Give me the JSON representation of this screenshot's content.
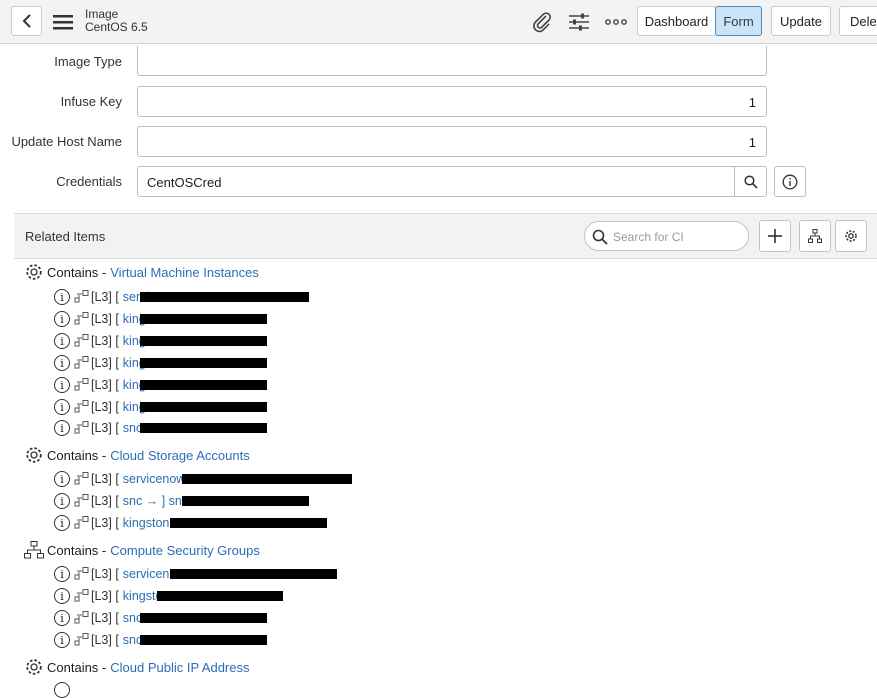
{
  "header": {
    "record_type": "Image",
    "record_name": "CentOS 6.5",
    "buttons": [
      "Dashboard",
      "Form",
      "Update",
      "Delet"
    ]
  },
  "form": {
    "fields": [
      {
        "label": "Image Type",
        "value": ""
      },
      {
        "label": "Infuse Key",
        "value": "1"
      },
      {
        "label": "Update Host Name",
        "value": "1"
      },
      {
        "label": "Credentials",
        "value": "CentOSCred"
      }
    ]
  },
  "related": {
    "title": "Related Items",
    "search_placeholder": "Search for CI",
    "contains_label": "Contains -",
    "groups": [
      {
        "name": "Virtual Machine Instances",
        "icon": "gear-icon",
        "items": [
          {
            "level": "[L3] [",
            "name": "servicenow"
          },
          {
            "level": "[L3] [",
            "name": "king"
          },
          {
            "level": "[L3] [",
            "name": "king"
          },
          {
            "level": "[L3] [",
            "name": "king"
          },
          {
            "level": "[L3] [",
            "name": "king"
          },
          {
            "level": "[L3] [",
            "name": "king"
          },
          {
            "level": "[L3] [",
            "name": "snc"
          }
        ]
      },
      {
        "name": "Cloud Storage Accounts",
        "icon": "gear-icon",
        "items": [
          {
            "level": "[L3] [",
            "name": "servicenow"
          },
          {
            "level": "[L3] [",
            "name": "snc  → ] snc"
          },
          {
            "level": "[L3] [",
            "name": "kingstonr"
          }
        ]
      },
      {
        "name": "Compute Security Groups",
        "icon": "network-icon",
        "items": [
          {
            "level": "[L3] [",
            "name": "servicenc"
          },
          {
            "level": "[L3] [",
            "name": "kingstc"
          },
          {
            "level": "[L3] [",
            "name": "snc"
          },
          {
            "level": "[L3] [",
            "name": "snc"
          }
        ]
      },
      {
        "name": "Cloud Public IP Address",
        "icon": "gear-icon",
        "items": []
      }
    ]
  },
  "colors": {
    "link": "#2a6db8",
    "active_button_bg": "#cde4f7"
  }
}
